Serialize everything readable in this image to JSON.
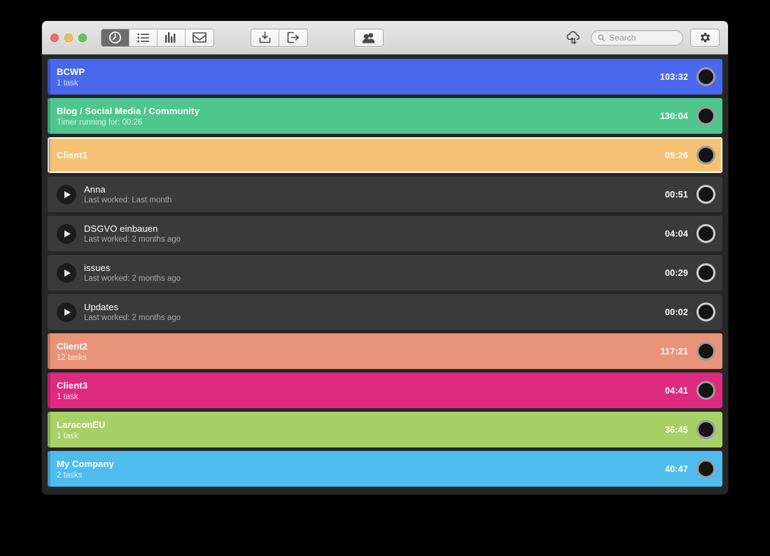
{
  "window": {
    "traffic_lights": [
      {
        "name": "close",
        "color": "#ef6a5f"
      },
      {
        "name": "minimize",
        "color": "#f4bd4f"
      },
      {
        "name": "zoom",
        "color": "#61c454"
      }
    ]
  },
  "toolbar": {
    "tabs": [
      {
        "icon": "timer-icon",
        "label": "Timer",
        "active": true
      },
      {
        "icon": "list-icon",
        "label": "List",
        "active": false
      },
      {
        "icon": "bar-chart-icon",
        "label": "Reports",
        "active": false
      },
      {
        "icon": "inbox-icon",
        "label": "Inbox",
        "active": false
      }
    ],
    "io_buttons": [
      {
        "icon": "import-icon",
        "label": "Import"
      },
      {
        "icon": "export-icon",
        "label": "Export"
      }
    ],
    "people_button": {
      "icon": "people-icon",
      "label": "Team"
    },
    "sync_button": {
      "icon": "cloud-sync-icon",
      "label": "Sync"
    },
    "search": {
      "placeholder": "Search",
      "value": "",
      "icon": "search-icon"
    },
    "settings_button": {
      "icon": "gear-icon",
      "label": "Settings"
    }
  },
  "rows": [
    {
      "kind": "project",
      "title": "BCWP",
      "subtitle": "1 task",
      "time": "103:32",
      "color": "#4a68ec",
      "selected": false
    },
    {
      "kind": "project",
      "title": "Blog / Social Media / Community",
      "subtitle": "Timer running for: 00:26",
      "time": "130:04",
      "color": "#4fc68c",
      "selected": false
    },
    {
      "kind": "project",
      "title": "Client1",
      "subtitle": "",
      "time": "05:26",
      "color": "#f5c172",
      "selected": true
    },
    {
      "kind": "task",
      "title": "Anna",
      "subtitle": "Last worked: Last month",
      "time": "00:51",
      "color": "#3a3a3a",
      "selected": false
    },
    {
      "kind": "task",
      "title": "DSGVO einbauen",
      "subtitle": "Last worked: 2 months ago",
      "time": "04:04",
      "color": "#3a3a3a",
      "selected": false
    },
    {
      "kind": "task",
      "title": "issues",
      "subtitle": "Last worked: 2 months ago",
      "time": "00:29",
      "color": "#3a3a3a",
      "selected": false
    },
    {
      "kind": "task",
      "title": "Updates",
      "subtitle": "Last worked: 2 months ago",
      "time": "00:02",
      "color": "#3a3a3a",
      "selected": false
    },
    {
      "kind": "project",
      "title": "Client2",
      "subtitle": "12 tasks",
      "time": "117:21",
      "color": "#e8947a",
      "selected": false
    },
    {
      "kind": "project",
      "title": "Client3",
      "subtitle": "1 task",
      "time": "04:41",
      "color": "#dd2a7e",
      "selected": false
    },
    {
      "kind": "project",
      "title": "LaraconEU",
      "subtitle": "1 task",
      "time": "36:45",
      "color": "#a7d167",
      "selected": false
    },
    {
      "kind": "project",
      "title": "My Company",
      "subtitle": "2 tasks",
      "time": "40:47",
      "color": "#4fbcee",
      "selected": false
    }
  ]
}
